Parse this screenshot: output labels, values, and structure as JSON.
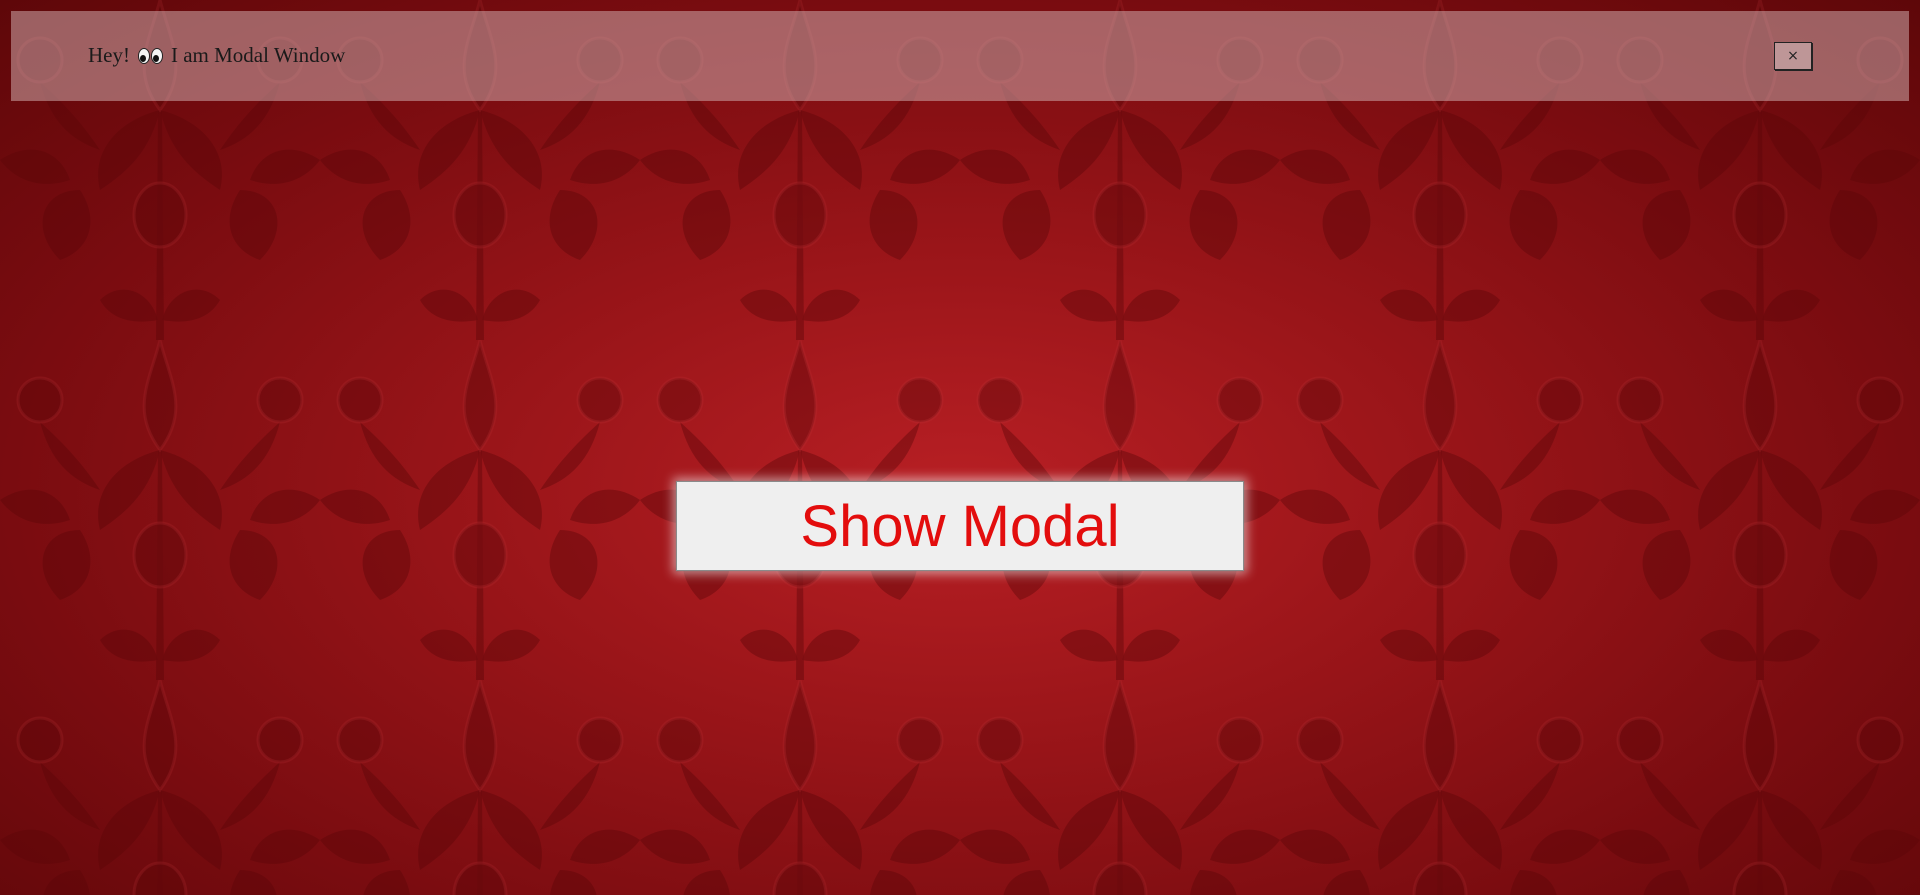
{
  "background": {
    "pattern_icon": "floral-damask-pattern",
    "base_color": "#9a1519",
    "dark_color": "#6a080b"
  },
  "modal": {
    "text_before": "Hey!",
    "emoji_icon": "eyes-emoji-icon",
    "text_after": "I am Modal Window",
    "close_label": "×",
    "close_icon": "close-icon"
  },
  "main": {
    "show_modal_label": "Show Modal",
    "text_color": "#e30d0d"
  }
}
